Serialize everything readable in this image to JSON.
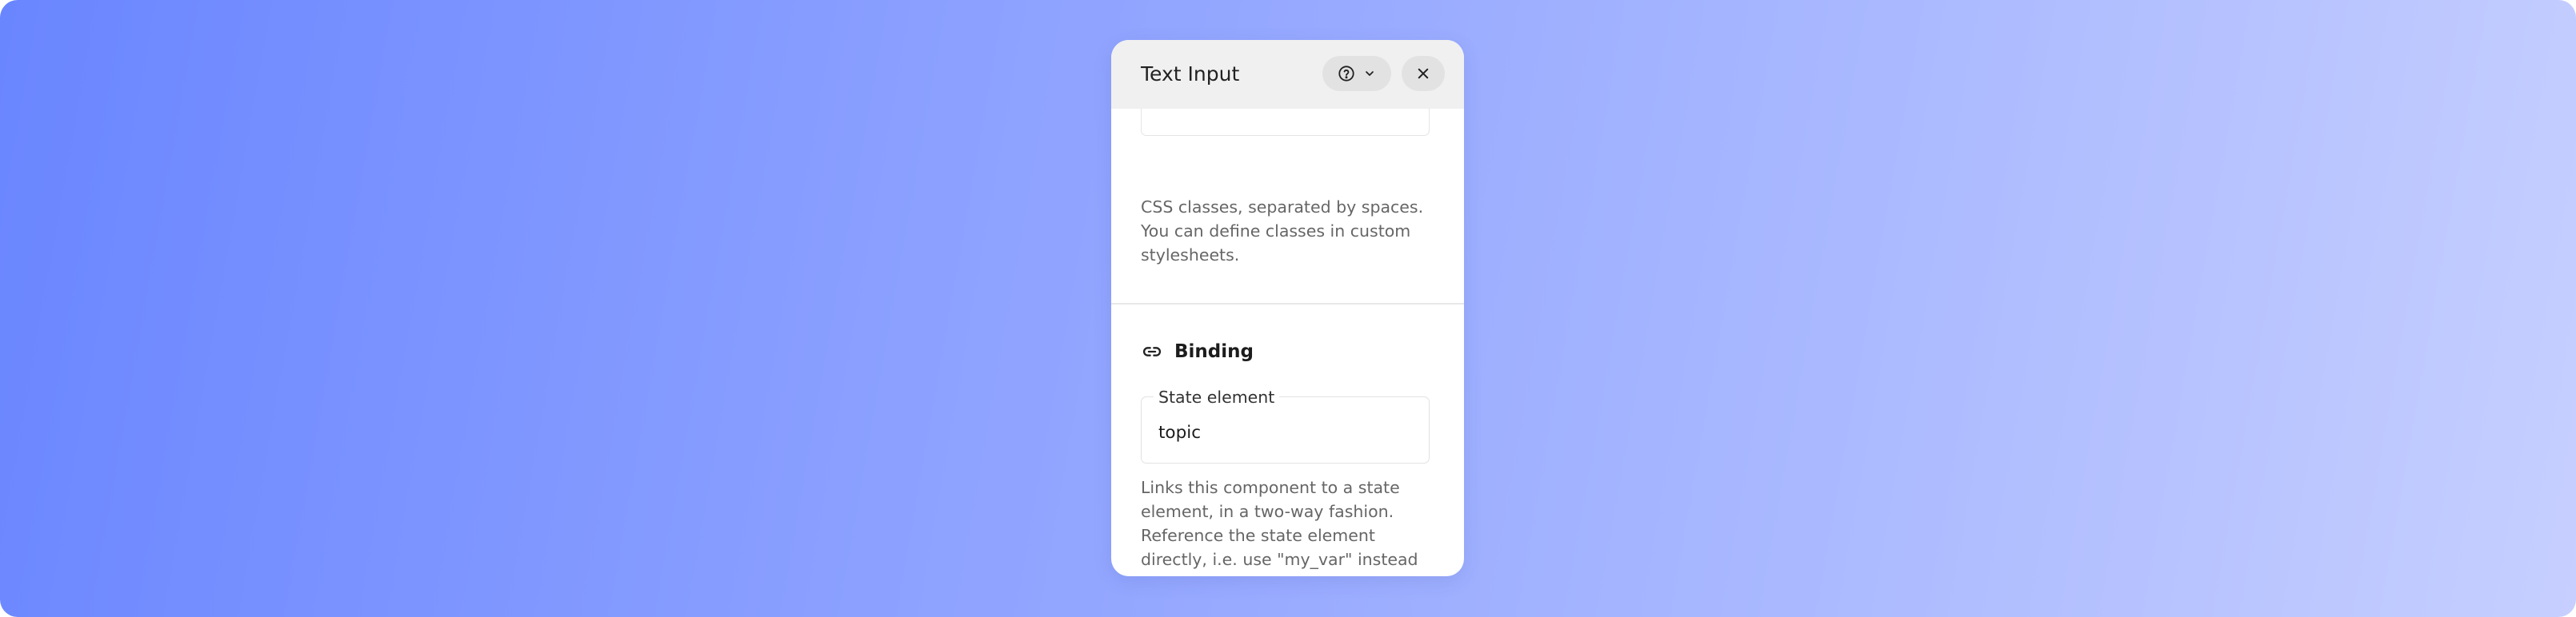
{
  "panel": {
    "title": "Text Input"
  },
  "header_buttons": {
    "help_icon": "question-circle-icon",
    "chevron_icon": "chevron-down-icon",
    "close_icon": "close-icon"
  },
  "classes_section": {
    "help_text": "CSS classes, separated by spaces. You can define classes in custom stylesheets."
  },
  "binding_section": {
    "icon": "link-icon",
    "title": "Binding",
    "state_element": {
      "label": "State element",
      "value": "topic"
    },
    "help_text": "Links this component to a state element, in a two-way fashion. Reference the state element directly, i.e. use \"my_var\" instead of \"@{my_var}\"."
  },
  "colors": {
    "gradient_start": "#6a86ff",
    "gradient_end": "#c6cfff",
    "header_bg": "#f0f0f0",
    "button_bg": "#e2e2e2"
  }
}
